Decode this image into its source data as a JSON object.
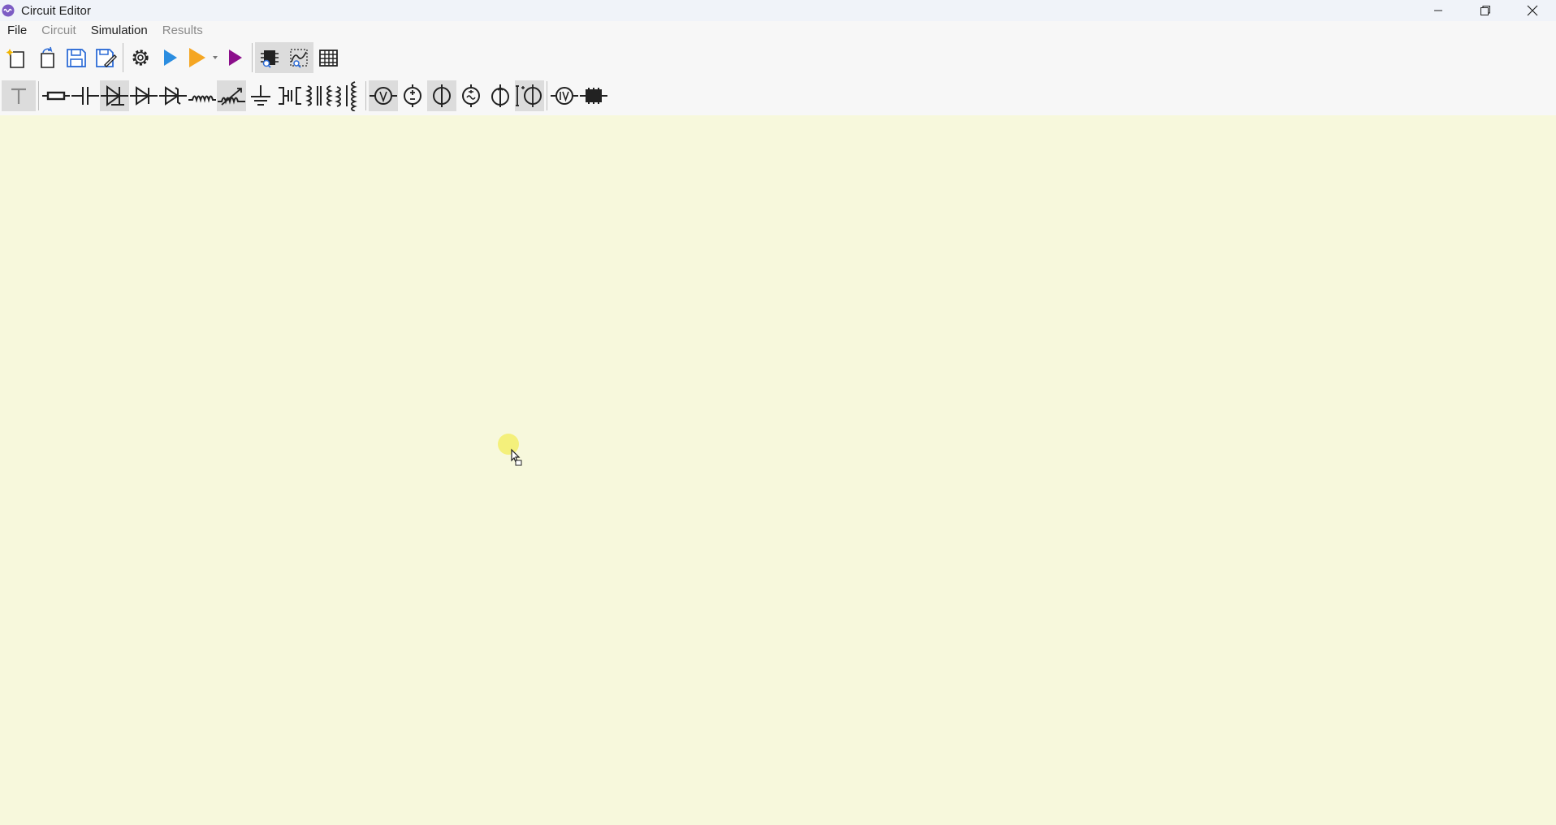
{
  "window": {
    "title": "Circuit Editor",
    "app_icon": "circuit-app-icon",
    "controls": [
      "minimize-icon",
      "maximize-icon",
      "close-icon"
    ]
  },
  "menubar": {
    "items": [
      {
        "label": "File",
        "enabled": true
      },
      {
        "label": "Circuit",
        "enabled": false
      },
      {
        "label": "Simulation",
        "enabled": true
      },
      {
        "label": "Results",
        "enabled": false
      }
    ]
  },
  "toolbar_main": {
    "icons": [
      "new-file-icon",
      "open-file-icon",
      "save-icon",
      "save-as-icon",
      "settings-gear-icon",
      "run-icon",
      "run-with-options-icon",
      "dropdown-arrow-icon",
      "run-step-icon",
      "component-inspector-icon",
      "probe-icon",
      "table-icon"
    ],
    "colors": {
      "run": "#2b8de0",
      "run_options": "#f5a623",
      "run_step": "#8b0f8b",
      "save": "#2d6cd6"
    }
  },
  "toolbar_components": {
    "icons": [
      "text-tool-icon",
      "resistor-icon",
      "capacitor-icon",
      "diode-icon",
      "diode-reverse-icon",
      "zener-diode-icon",
      "inductor-icon",
      "variable-inductor-icon",
      "ground-icon",
      "switch-icon",
      "transformer-icon",
      "transformer-coupled-icon",
      "voltmeter-icon",
      "voltage-source-icon",
      "current-source-icon",
      "ac-source-icon",
      "controlled-source-icon",
      "variable-source-icon",
      "iv-meter-icon",
      "chip-icon"
    ],
    "selected": [
      "text-tool-icon",
      "diode-icon",
      "variable-inductor-icon",
      "voltmeter-icon",
      "current-source-icon",
      "variable-source-icon"
    ]
  },
  "canvas": {
    "background": "#f7f8dc",
    "cursor": "pointer-with-highlight-icon"
  }
}
